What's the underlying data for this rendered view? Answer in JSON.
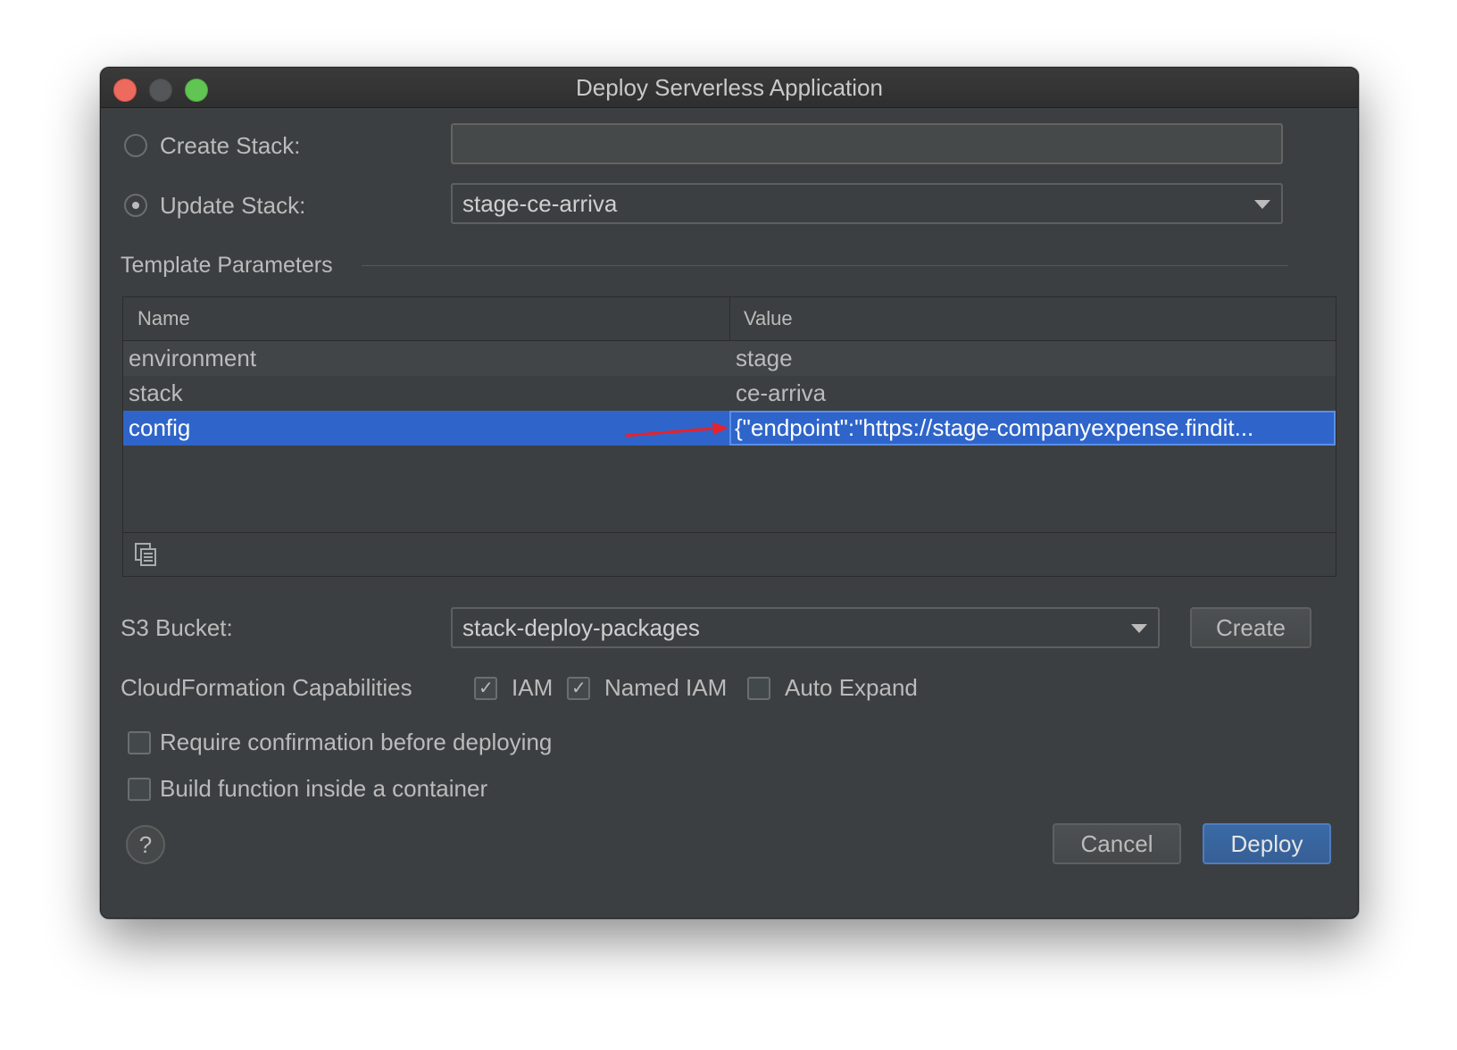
{
  "window": {
    "title": "Deploy Serverless Application"
  },
  "create_stack": {
    "label": "Create Stack:",
    "value": "",
    "selected": false
  },
  "update_stack": {
    "label": "Update Stack:",
    "value": "stage-ce-arriva",
    "selected": true
  },
  "template_parameters": {
    "heading": "Template Parameters",
    "columns": [
      "Name",
      "Value"
    ],
    "rows": [
      {
        "name": "environment",
        "value": "stage"
      },
      {
        "name": "stack",
        "value": "ce-arriva"
      },
      {
        "name": "config",
        "value": "{\"endpoint\":\"https://stage-companyexpense.findit...",
        "selected": true
      }
    ]
  },
  "s3_bucket": {
    "label": "S3 Bucket:",
    "value": "stack-deploy-packages",
    "create_label": "Create"
  },
  "capabilities": {
    "label": "CloudFormation Capabilities",
    "items": [
      {
        "label": "IAM",
        "checked": true
      },
      {
        "label": "Named IAM",
        "checked": true
      },
      {
        "label": "Auto Expand",
        "checked": false
      }
    ]
  },
  "options": [
    {
      "label": "Require confirmation before deploying",
      "checked": false
    },
    {
      "label": "Build function inside a container",
      "checked": false
    }
  ],
  "buttons": {
    "help": "?",
    "cancel": "Cancel",
    "deploy": "Deploy"
  },
  "colors": {
    "accent": "#2f65ca",
    "annotation_arrow": "#e8212a",
    "close": "#ed6a5e",
    "zoom": "#61c554"
  }
}
